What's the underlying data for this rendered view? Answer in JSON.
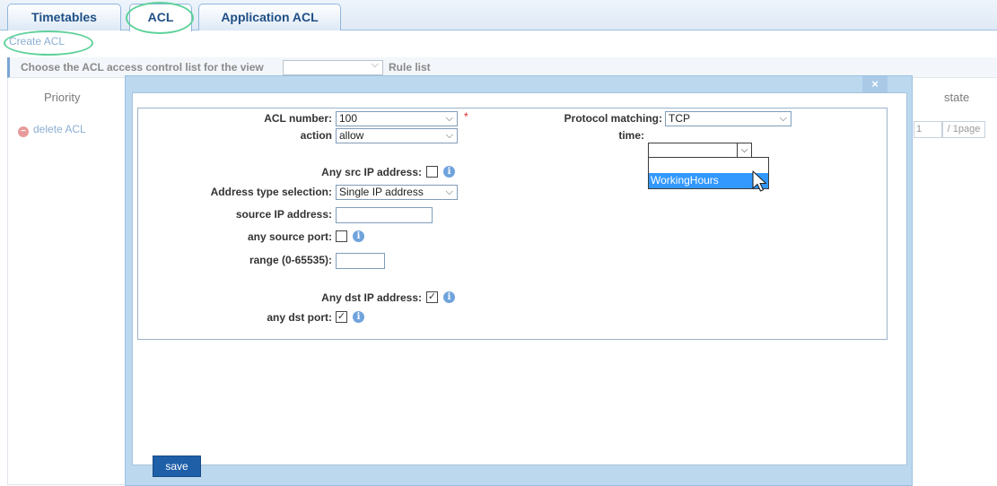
{
  "tabs": [
    {
      "label": "Timetables"
    },
    {
      "label": "ACL"
    },
    {
      "label": "Application ACL"
    }
  ],
  "toolbar": {
    "create_acl": "Create ACL"
  },
  "filter": {
    "label": "Choose the ACL access control list for the view",
    "view_value": "",
    "rule_list": "Rule list"
  },
  "table": {
    "priority_header": "Priority",
    "state_header": "state",
    "delete_acl": "delete ACL",
    "page_current": "1",
    "page_total": "/ 1page"
  },
  "modal": {
    "close_label": "×",
    "save_label": "save",
    "form": {
      "acl_number_label": "ACL number:",
      "acl_number_value": "100",
      "required_mark": "*",
      "action_label": "action",
      "action_value": "allow",
      "protocol_label": "Protocol matching:",
      "protocol_value": "TCP",
      "time_label": "time:",
      "time_value": "",
      "time_options": [
        "",
        "WorkingHours"
      ],
      "any_src_ip_label": "Any src IP address:",
      "any_src_ip_checked": false,
      "address_type_label": "Address type selection:",
      "address_type_value": "Single IP address",
      "source_ip_label": "source IP address:",
      "source_ip_value": "",
      "any_source_port_label": "any source port:",
      "any_source_port_checked": false,
      "range_label": "range (0-65535):",
      "range_value": "",
      "any_dst_ip_label": "Any dst IP address:",
      "any_dst_ip_checked": true,
      "any_dst_port_label": "any dst port:",
      "any_dst_port_checked": true
    }
  },
  "icons": {
    "chevron": "chevron-down-icon",
    "info": "info-icon",
    "delete": "minus-circle-icon",
    "cursor": "mouse-pointer-icon"
  },
  "colors": {
    "tab_text": "#1f4f86",
    "highlight_oval": "#5fd19a",
    "modal_frame": "#bcd8ef",
    "save_button": "#1f5fa8",
    "dropdown_selected": "#3399ff",
    "required": "#e02020"
  }
}
